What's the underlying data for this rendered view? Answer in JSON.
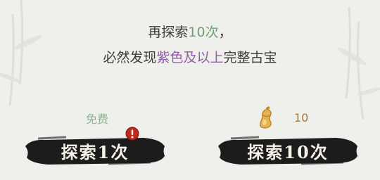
{
  "notice": {
    "line1_prefix": "再探索",
    "line1_count": "10次",
    "line1_suffix": "，",
    "line2_prefix": "必然发现",
    "line2_quality": "紫色及以上",
    "line2_suffix": "完整古宝"
  },
  "single_draw": {
    "cost_label": "免费",
    "button_label": "探索1次",
    "has_alert_badge": true
  },
  "ten_draw": {
    "currency_icon": "golden-gourd-icon",
    "cost_amount": "10",
    "button_label": "探索10次"
  },
  "colors": {
    "count_highlight": "#6f9f78",
    "quality_purple": "#8f5ea8",
    "free_green": "#8fb493",
    "cost_brown": "#a37a45",
    "button_ink": "#1c1c1c",
    "badge_red": "#c0271f"
  }
}
